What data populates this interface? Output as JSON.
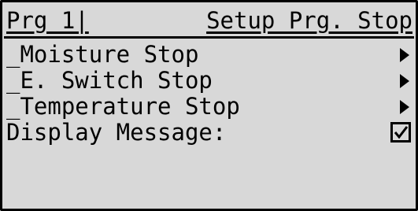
{
  "header": {
    "program_label": "Prg 1|",
    "screen_title": "Setup Prg. Stop"
  },
  "menu": {
    "items": [
      {
        "label": "_Moisture Stop",
        "icon": "right-arrow-icon"
      },
      {
        "label": "_E. Switch Stop",
        "icon": "right-arrow-icon"
      },
      {
        "label": "_Temperature Stop",
        "icon": "right-arrow-icon"
      }
    ],
    "display_message": {
      "label": "Display Message:",
      "checked": true,
      "icon": "checkbox-checked-icon"
    }
  },
  "colors": {
    "background": "#d8d8d8",
    "foreground": "#000000"
  }
}
